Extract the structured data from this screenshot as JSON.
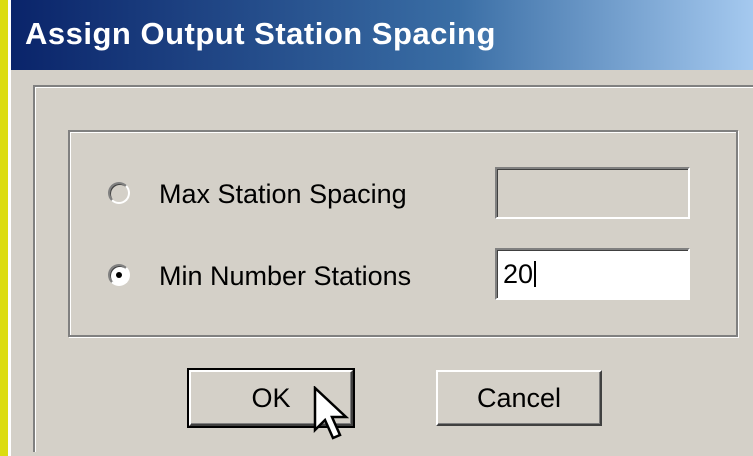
{
  "dialog": {
    "title": "Assign Output Station Spacing"
  },
  "options": {
    "max_spacing": {
      "label": "Max Station Spacing",
      "selected": false,
      "value": ""
    },
    "min_stations": {
      "label": "Min Number Stations",
      "selected": true,
      "value": "20"
    }
  },
  "buttons": {
    "ok_label": "OK",
    "cancel_label": "Cancel"
  },
  "colors": {
    "title_bar_start": "#0a246a",
    "title_bar_end": "#a6caf0",
    "dialog_face": "#d4d0c8",
    "background": "#dcdc10"
  },
  "icons": {
    "cursor": "arrow-pointer-icon"
  }
}
